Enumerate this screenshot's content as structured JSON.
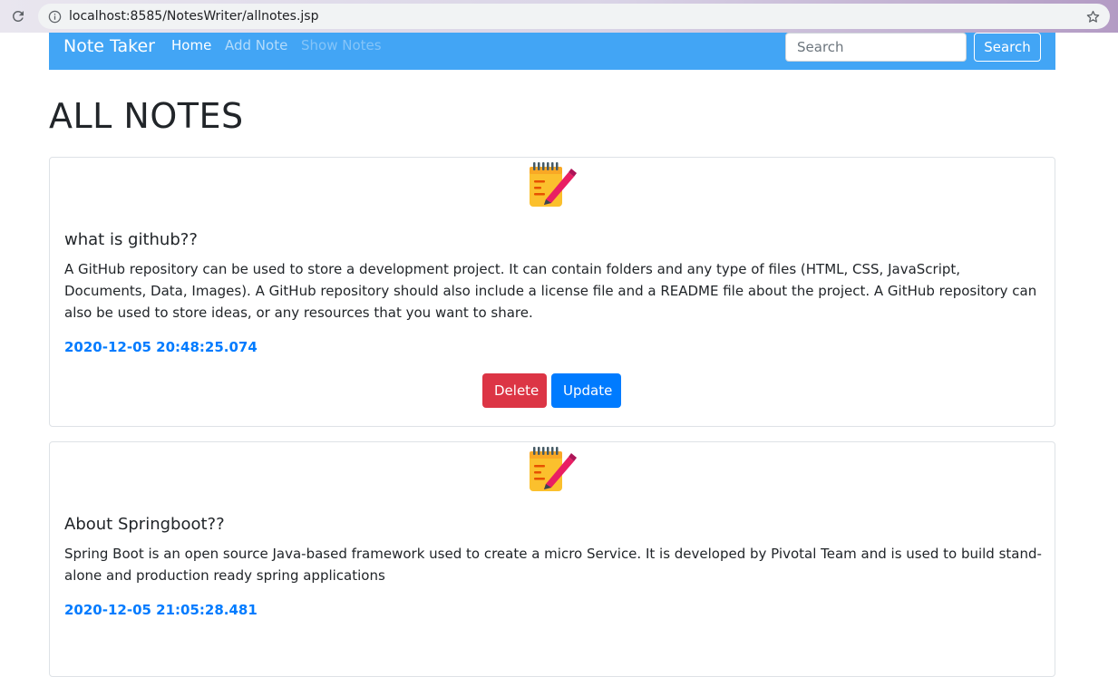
{
  "browser": {
    "url": "localhost:8585/NotesWriter/allnotes.jsp"
  },
  "navbar": {
    "brand": "Note Taker",
    "links": [
      {
        "label": "Home"
      },
      {
        "label": "Add Note"
      },
      {
        "label": "Show Notes"
      }
    ],
    "search_placeholder": "Search",
    "search_button": "Search"
  },
  "page": {
    "title": "ALL NOTES"
  },
  "notes": [
    {
      "title": "what is github??",
      "content": "A GitHub repository can be used to store a development project. It can contain folders and any type of files (HTML, CSS, JavaScript, Documents, Data, Images). A GitHub repository should also include a license file and a README file about the project. A GitHub repository can also be used to store ideas, or any resources that you want to share.",
      "date": "2020-12-05 20:48:25.074",
      "delete_label": "Delete",
      "update_label": "Update"
    },
    {
      "title": "About Springboot??",
      "content": "Spring Boot is an open source Java-based framework used to create a micro Service. It is developed by Pivotal Team and is used to build stand-alone and production ready spring applications",
      "date": "2020-12-05 21:05:28.481"
    }
  ],
  "colors": {
    "navbar": "#42a5f5",
    "date": "#007bff",
    "delete": "#dc3545",
    "update": "#007bff"
  }
}
